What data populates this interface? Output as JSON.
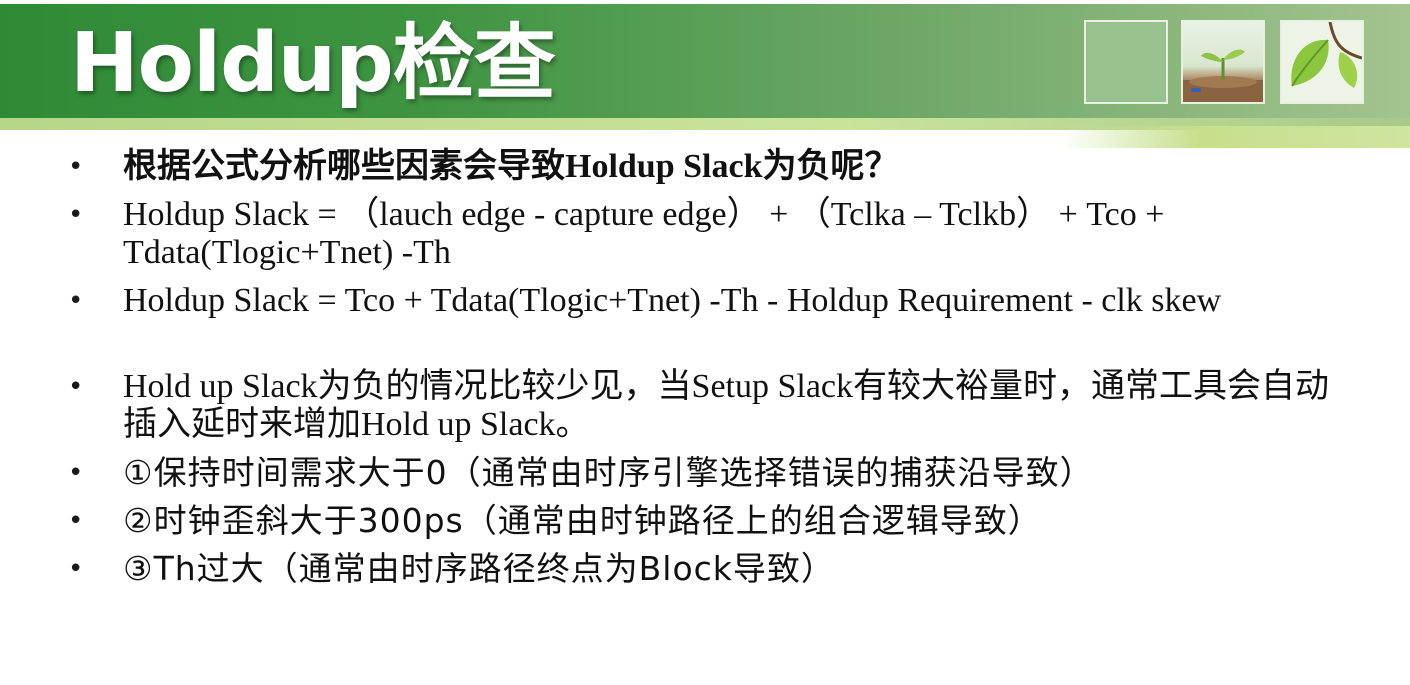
{
  "slide": {
    "title": "Holdup检查",
    "bullets": [
      {
        "text": "根据公式分析哪些因素会导致Holdup Slack为负呢？"
      },
      {
        "text": "Holdup Slack = （lauch edge - capture edge） + （Tclka – Tclkb） + Tco + Tdata(Tlogic+Tnet) -Th"
      },
      {
        "text": "Holdup Slack =  Tco + Tdata(Tlogic+Tnet) -Th - Holdup Requirement - clk skew"
      },
      {
        "text": "Hold up Slack为负的情况比较少见，当Setup Slack有较大裕量时，通常工具会自动插入延时来增加Hold up Slack。"
      },
      {
        "text": "①保持时间需求大于0（通常由时序引擎选择错误的捕获沿导致）"
      },
      {
        "text": "②时钟歪斜大于300ps（通常由时钟路径上的组合逻辑导致）"
      },
      {
        "text": "③Th过大（通常由时序路径终点为Block导致）"
      }
    ],
    "bullet_glyph": "•"
  },
  "colors": {
    "header_green": "#3e9441",
    "stripe_light": "#c9e39b",
    "text": "#111111"
  }
}
